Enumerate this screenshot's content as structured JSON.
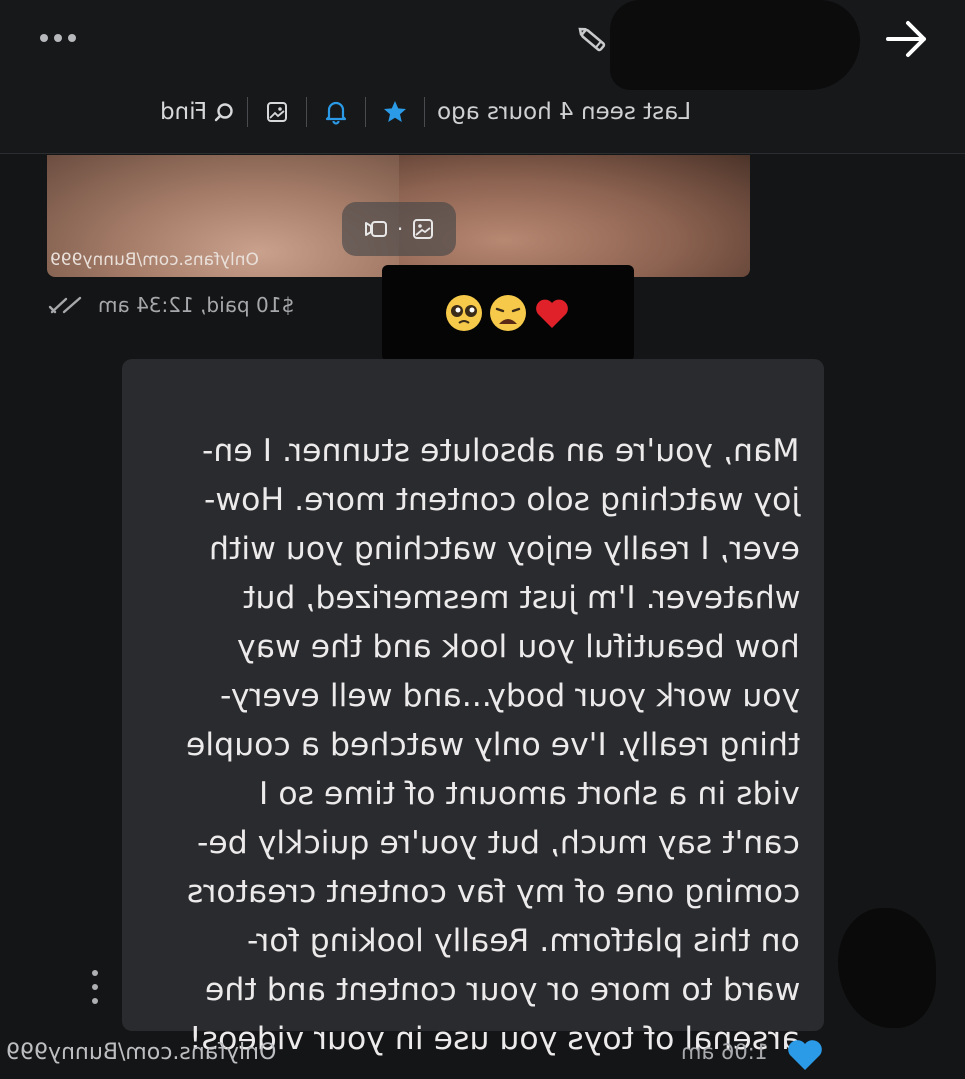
{
  "header": {
    "status": "Last seen 4 hours ago",
    "find_label": "Find",
    "icons": [
      "more-icon",
      "edit-icon",
      "back-arrow-icon",
      "star-icon",
      "bell-icon",
      "media-icon",
      "search-icon"
    ]
  },
  "media": {
    "watermark": "Onlyfans.com/Bunny999",
    "meta": "$10 paid, 12:34 am"
  },
  "reaction": {
    "emojis": [
      "pleading-face",
      "weary-face",
      "red-heart"
    ]
  },
  "message": {
    "lines": [
      "Man, you're an absolute stunner. I en-",
      "joy watching solo content more. How-",
      "ever, I really enjoy watching you with",
      "whatever. I'm just mesmerized, but",
      "how beautiful you look and the way",
      "you work your body...and well every-",
      "thing really. I've only watched a couple",
      "vids in a short amount of time so I",
      "can't say much, but you're quickly be-",
      "coming one of my fav content creators",
      "on this platform. Really looking for-",
      "ward to more or your content and the",
      "arsenal of toys you use in your videos!"
    ],
    "time": "1:06 am"
  },
  "footer": {
    "watermark": "Onlyfans.com/Bunny999"
  },
  "colors": {
    "background": "#141516",
    "bubble": "#2a2b2e",
    "accent": "#2b9be8",
    "text": "#eceaea"
  }
}
